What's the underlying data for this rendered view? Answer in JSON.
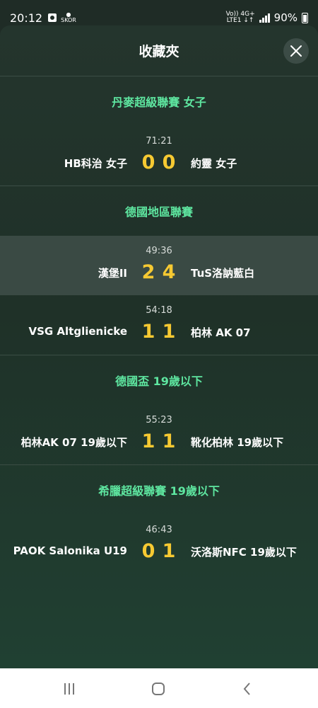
{
  "status_bar": {
    "time": "20:12",
    "skores_label": "SKOR",
    "network_top": "Vo)) 4G+",
    "network_bottom": "LTE1 ↓↑",
    "battery": "90%"
  },
  "header": {
    "title": "收藏夾"
  },
  "sections": [
    {
      "league": "丹麥超級聯賽 女子",
      "matches": [
        {
          "time": "71:21",
          "home": "HB科治 女子",
          "home_score": "0",
          "away_score": "0",
          "away": "約靈 女子",
          "highlighted": false
        }
      ]
    },
    {
      "league": "德國地區聯賽",
      "matches": [
        {
          "time": "49:36",
          "home": "漢堡II",
          "home_score": "2",
          "away_score": "4",
          "away": "TuS洛訥藍白",
          "highlighted": true
        },
        {
          "time": "54:18",
          "home": "VSG Altglienicke",
          "home_score": "1",
          "away_score": "1",
          "away": "柏林 AK 07",
          "highlighted": false
        }
      ]
    },
    {
      "league": "德國盃 19歲以下",
      "matches": [
        {
          "time": "55:23",
          "home": "柏林AK 07 19歲以下",
          "home_score": "1",
          "away_score": "1",
          "away": "靴化柏林 19歲以下",
          "highlighted": false
        }
      ]
    },
    {
      "league": "希臘超級聯賽 19歲以下",
      "matches": [
        {
          "time": "46:43",
          "home": "PAOK Salonika U19",
          "home_score": "0",
          "away_score": "1",
          "away": "沃洛斯NFC 19歲以下",
          "highlighted": false
        }
      ]
    }
  ],
  "colors": {
    "accent_league": "#5ee6a0",
    "score": "#f6c932",
    "highlight_row": "#3a4a44"
  },
  "icons": {
    "close": "close-icon",
    "recents": "recents-icon",
    "home": "home-icon",
    "back": "back-icon"
  }
}
